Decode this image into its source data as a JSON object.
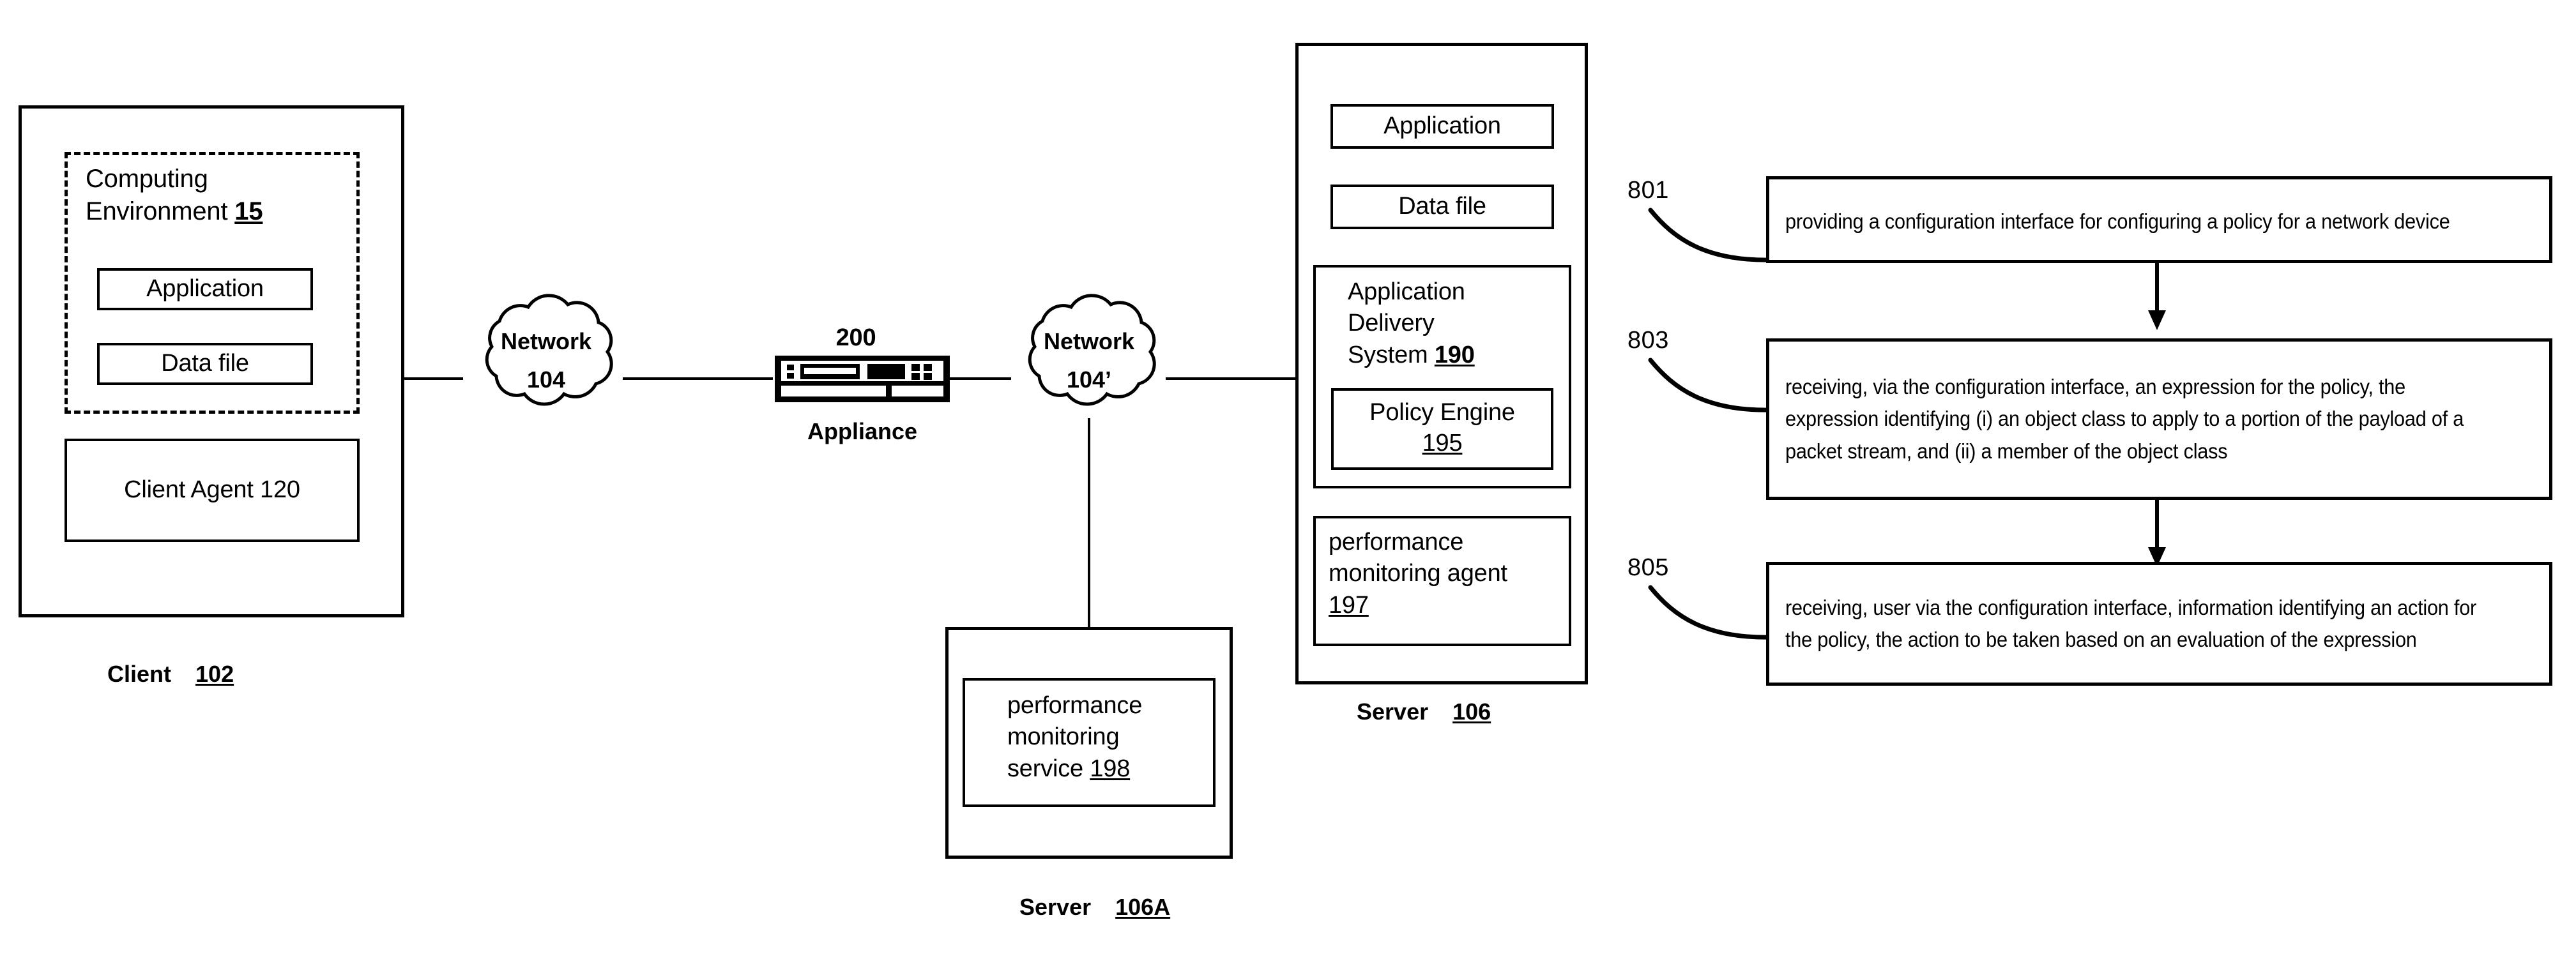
{
  "figure": {
    "client": {
      "caption_label": "Client",
      "caption_ref": "102",
      "computing_environment": {
        "title_line1": "Computing",
        "title_line2": "Environment",
        "ref": "15",
        "application_label": "Application",
        "data_file_label": "Data file"
      },
      "client_agent_label": "Client Agent 120"
    },
    "network_left": {
      "name": "Network",
      "ref": "104"
    },
    "network_right": {
      "name": "Network",
      "ref": "104’"
    },
    "appliance": {
      "ref": "200",
      "label": "Appliance"
    },
    "server_106": {
      "caption_label": "Server",
      "caption_ref": "106",
      "application_label": "Application",
      "data_file_label": "Data file",
      "ads": {
        "line1": "Application",
        "line2": "Delivery",
        "line3": "System",
        "ref": "190",
        "policy_engine": {
          "title": "Policy Engine",
          "ref": "195"
        }
      },
      "perf_agent": {
        "line1": "performance",
        "line2": "monitoring agent",
        "ref": "197"
      }
    },
    "server_106a": {
      "caption_label": "Server",
      "caption_ref": "106A",
      "perf_service": {
        "line1": "performance",
        "line2": "monitoring",
        "line3_prefix": "service ",
        "ref": "198"
      }
    },
    "flowchart": {
      "steps": [
        {
          "ref": "801",
          "text": "providing a configuration interface for configuring a policy for a network device"
        },
        {
          "ref": "803",
          "text": "receiving, via the configuration interface, an expression for the policy, the expression identifying (i) an object class to apply to a portion of the payload of a packet stream, and (ii) a member of the object class"
        },
        {
          "ref": "805",
          "text": "receiving, user via the configuration interface, information identifying an action for the policy, the action to be taken based on an evaluation of the expression"
        }
      ]
    }
  },
  "colors": {
    "ink": "#000000",
    "paper": "#ffffff"
  }
}
